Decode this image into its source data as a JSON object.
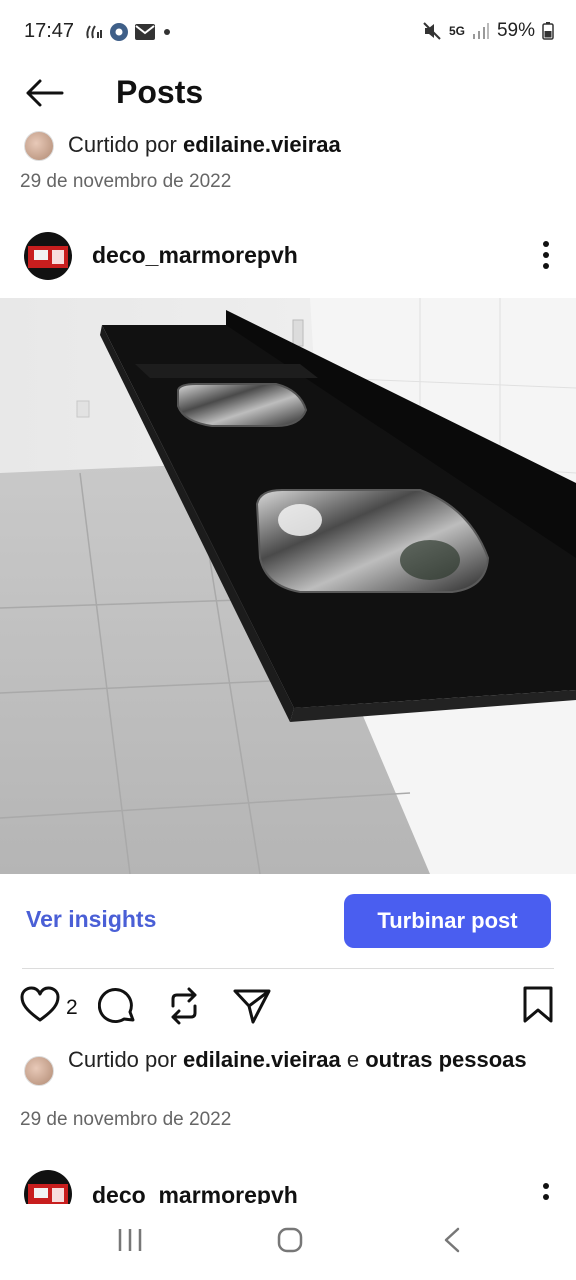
{
  "status_bar": {
    "time": "17:47",
    "battery": "59%",
    "network": "5G"
  },
  "header": {
    "title": "Posts"
  },
  "previous_post": {
    "liked_prefix": "Curtido por",
    "liked_user": "edilaine.vieiraa",
    "date": "29 de novembro de 2022"
  },
  "post": {
    "username": "deco_marmorepvh",
    "insights_label": "Ver insights",
    "boost_label": "Turbinar post",
    "like_count": "2",
    "liked_prefix": "Curtido por",
    "liked_user": "edilaine.vieiraa",
    "liked_joiner": "e",
    "liked_others": "outras pessoas",
    "date": "29 de novembro de 2022"
  },
  "next_post": {
    "username": "deco_marmorepvh"
  },
  "colors": {
    "accent": "#4a5ef0",
    "link": "#4a5fd6"
  }
}
